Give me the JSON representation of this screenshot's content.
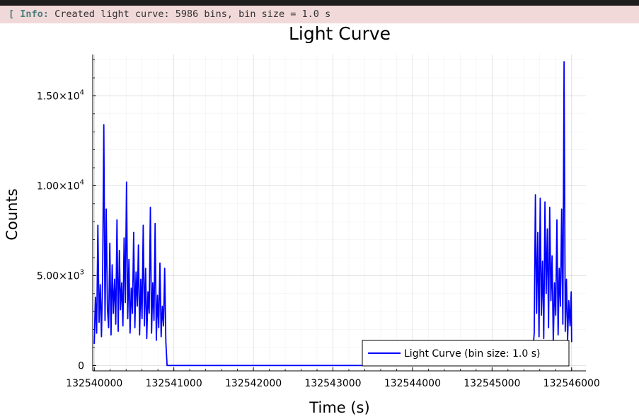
{
  "log": {
    "bracket": "[",
    "level": "Info:",
    "message": "Created light curve: 5986 bins, bin size = 1.0 s"
  },
  "chart_data": {
    "type": "line",
    "title": "Light Curve",
    "xlabel": "Time (s)",
    "ylabel": "Counts",
    "xlim": [
      132539980,
      132546180
    ],
    "ylim": [
      -300,
      17300
    ],
    "x_ticks": [
      132540000,
      132541000,
      132542000,
      132543000,
      132544000,
      132545000,
      132546000
    ],
    "x_tick_labels": [
      "132540000",
      "132541000",
      "132542000",
      "132543000",
      "132544000",
      "132545000",
      "132546000"
    ],
    "y_ticks": [
      0,
      5000,
      10000,
      15000
    ],
    "y_tick_labels": [
      {
        "mantissa": "0",
        "exponent": ""
      },
      {
        "mantissa": "5.00×10",
        "exponent": "3"
      },
      {
        "mantissa": "1.00×10",
        "exponent": "4"
      },
      {
        "mantissa": "1.50×10",
        "exponent": "4"
      }
    ],
    "grid": true,
    "legend_position": "bottom-right",
    "series": [
      {
        "name": "Light Curve (bin size: 1.0 s)",
        "color": "#0000ff",
        "x": [
          132540000,
          132540015,
          132540030,
          132540045,
          132540060,
          132540075,
          132540090,
          132540105,
          132540120,
          132540135,
          132540150,
          132540165,
          132540180,
          132540195,
          132540210,
          132540225,
          132540240,
          132540255,
          132540270,
          132540285,
          132540300,
          132540315,
          132540330,
          132540345,
          132540360,
          132540375,
          132540390,
          132540405,
          132540420,
          132540435,
          132540450,
          132540465,
          132540480,
          132540495,
          132540510,
          132540525,
          132540540,
          132540555,
          132540570,
          132540585,
          132540600,
          132540615,
          132540630,
          132540645,
          132540660,
          132540675,
          132540690,
          132540705,
          132540720,
          132540735,
          132540750,
          132540765,
          132540780,
          132540795,
          132540810,
          132540825,
          132540840,
          132540855,
          132540870,
          132540885,
          132540900,
          132540915,
          132541000,
          132542000,
          132543000,
          132544000,
          132545000,
          132545500,
          132545530,
          132545545,
          132545560,
          132545575,
          132545590,
          132545605,
          132545620,
          132545635,
          132545650,
          132545665,
          132545680,
          132545695,
          132545710,
          132545725,
          132545740,
          132545755,
          132545770,
          132545785,
          132545800,
          132545815,
          132545830,
          132545845,
          132545860,
          132545875,
          132545890,
          132545905,
          132545920,
          132545935,
          132545950,
          132545965,
          132545980,
          132545995,
          132546000
        ],
        "y": [
          1200,
          3800,
          1800,
          7800,
          2400,
          4500,
          1600,
          5200,
          13400,
          2500,
          8700,
          3200,
          2100,
          6800,
          1700,
          5600,
          2900,
          4800,
          2300,
          8100,
          1900,
          6400,
          3100,
          4600,
          2200,
          7100,
          3500,
          10200,
          2600,
          5900,
          1800,
          4300,
          2900,
          7400,
          2100,
          5200,
          3300,
          6700,
          1700,
          4800,
          2600,
          7800,
          2200,
          5400,
          1500,
          4100,
          2900,
          8800,
          1800,
          4600,
          2500,
          7900,
          1400,
          3900,
          2100,
          5700,
          1600,
          3300,
          2200,
          5400,
          1300,
          0,
          0,
          0,
          0,
          0,
          0,
          0,
          1800,
          9500,
          2900,
          7400,
          1600,
          9300,
          2800,
          5800,
          1500,
          9100,
          4000,
          7600,
          2100,
          8800,
          3600,
          6100,
          1200,
          4600,
          2800,
          8100,
          1700,
          5400,
          3300,
          8700,
          2300,
          16900,
          1900,
          4800,
          1400,
          3600,
          2200,
          4100,
          1300
        ]
      }
    ]
  }
}
